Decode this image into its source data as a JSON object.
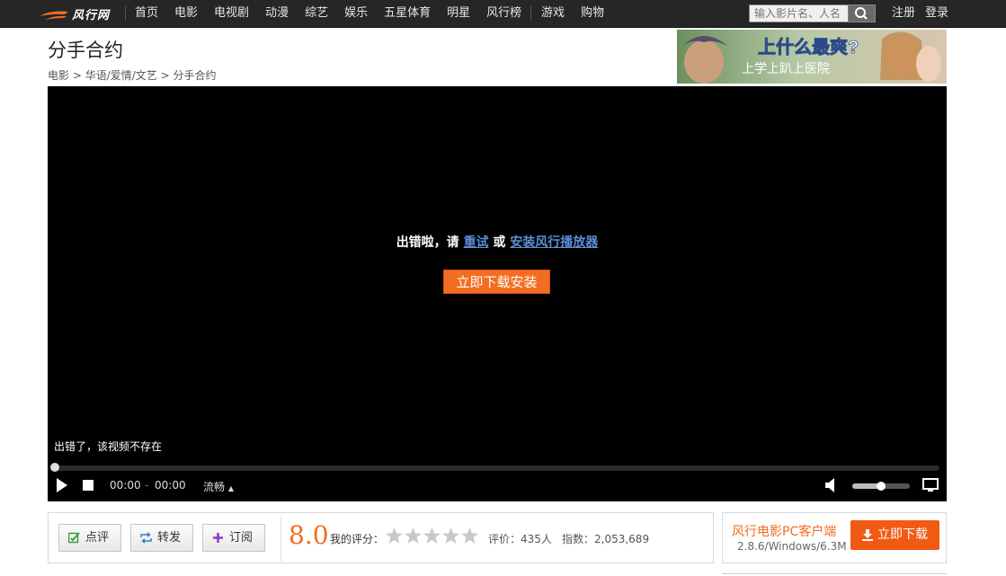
{
  "topnav": {
    "logo": "风行网",
    "items": [
      "首页",
      "电影",
      "电视剧",
      "动漫",
      "综艺",
      "娱乐",
      "五星体育",
      "明星",
      "风行榜"
    ],
    "extra_items": [
      "游戏",
      "购物"
    ],
    "search_placeholder": "输入影片名、人名",
    "register": "注册",
    "login": "登录"
  },
  "header": {
    "title": "分手合约",
    "breadcrumb": [
      "电影",
      "华语/爱情/文艺",
      "分手合约"
    ],
    "breadcrumb_sep": " > "
  },
  "ad": {
    "headline": "上什么最爽?",
    "subline": "上学上趴上医院"
  },
  "player": {
    "error_prefix": "出错啦，请 ",
    "retry": "重试",
    "or": " 或 ",
    "install": "安装风行播放器",
    "download_button": "立即下载安装",
    "bottom_error": "出错了，该视频不存在",
    "time_current": "00:00",
    "time_sep": "-",
    "time_total": "00:00",
    "quality": "流畅",
    "progress": 0,
    "volume": 0.5
  },
  "actions": {
    "comment": "点评",
    "share": "转发",
    "subscribe": "订阅",
    "score": "8.0",
    "my_rating_label": "我的评分：",
    "stars_filled": 0,
    "stars_total": 5,
    "rating_count": "评价：435人",
    "index": "指数：2,053,689"
  },
  "client": {
    "name": "风行电影PC客户端",
    "version": "2.8.6/Windows/6.3M",
    "download": "立即下载"
  },
  "colors": {
    "accent": "#f36d21",
    "topbar": "#262626",
    "link": "#5b8fd6"
  }
}
